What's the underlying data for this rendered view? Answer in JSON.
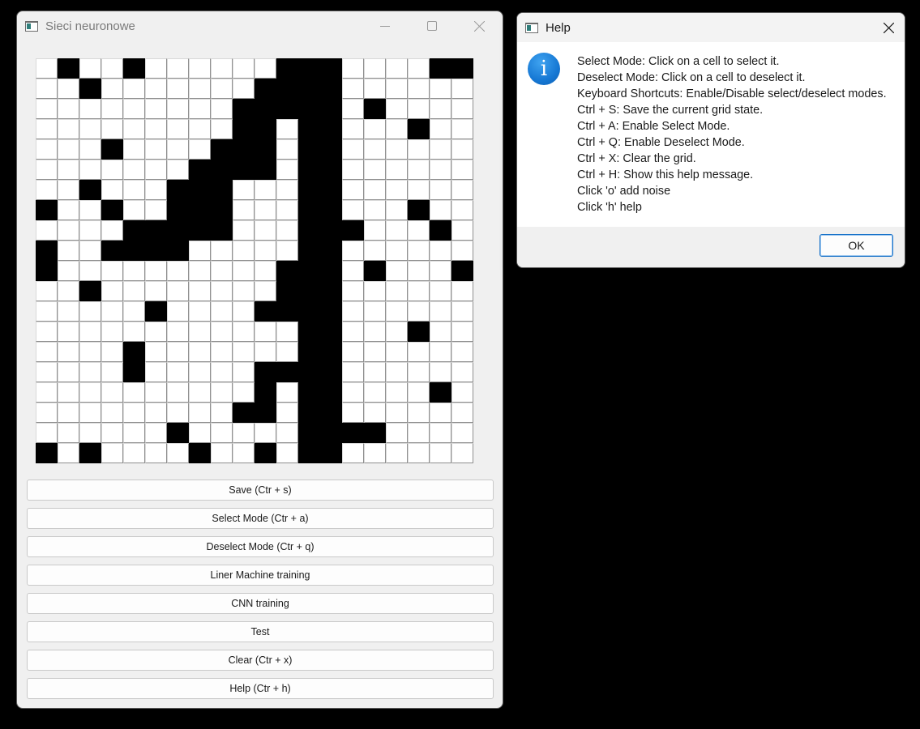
{
  "main_window": {
    "title": "Sieci neuronowe",
    "grid": {
      "rows": 20,
      "cols": 20,
      "cells": [
        "01001000000111000011",
        "00100000001111000000",
        "00000000011111010000",
        "00000000011011000100",
        "00010000111011000000",
        "00000001111011000000",
        "00100011100011000000",
        "10010011100011000100",
        "00001111100011100010",
        "10011110000011000000",
        "10000000000111010001",
        "00100000000111000000",
        "00000100001111000000",
        "00000000000011000100",
        "00001000000011000000",
        "00001000001111000000",
        "00000000001011000010",
        "00000000011011000000",
        "00000010000011110000",
        "10100001001011000000"
      ]
    },
    "buttons": [
      {
        "id": "save-button",
        "label": "Save (Ctr + s)"
      },
      {
        "id": "select-mode-button",
        "label": "Select Mode (Ctr + a)"
      },
      {
        "id": "deselect-mode-button",
        "label": "Deselect Mode (Ctr + q)"
      },
      {
        "id": "linear-machine-training-button",
        "label": "Liner Machine training"
      },
      {
        "id": "cnn-training-button",
        "label": "CNN training"
      },
      {
        "id": "test-button",
        "label": "Test"
      },
      {
        "id": "clear-button",
        "label": "Clear (Ctr + x)"
      },
      {
        "id": "help-button",
        "label": "Help (Ctr + h)"
      }
    ]
  },
  "help_dialog": {
    "title": "Help",
    "icon": "info-icon",
    "icon_glyph": "i",
    "lines": [
      "Select Mode: Click on a cell to select it.",
      "Deselect Mode: Click on a cell to deselect it.",
      "Keyboard Shortcuts: Enable/Disable select/deselect modes.",
      "Ctrl + S: Save the current grid state.",
      "Ctrl + A: Enable Select Mode.",
      "Ctrl + Q: Enable Deselect Mode.",
      "Ctrl + X: Clear the grid.",
      "Ctrl + H: Show this help message.",
      "Click 'o' add noise",
      "Click 'h' help"
    ],
    "ok_label": "OK"
  },
  "colors": {
    "desktop": "#000000",
    "window_bg": "#f0f0f0",
    "cell_on": "#000000",
    "cell_off": "#ffffff",
    "info_icon": "#1678d4",
    "ok_border": "#1a73c9"
  }
}
